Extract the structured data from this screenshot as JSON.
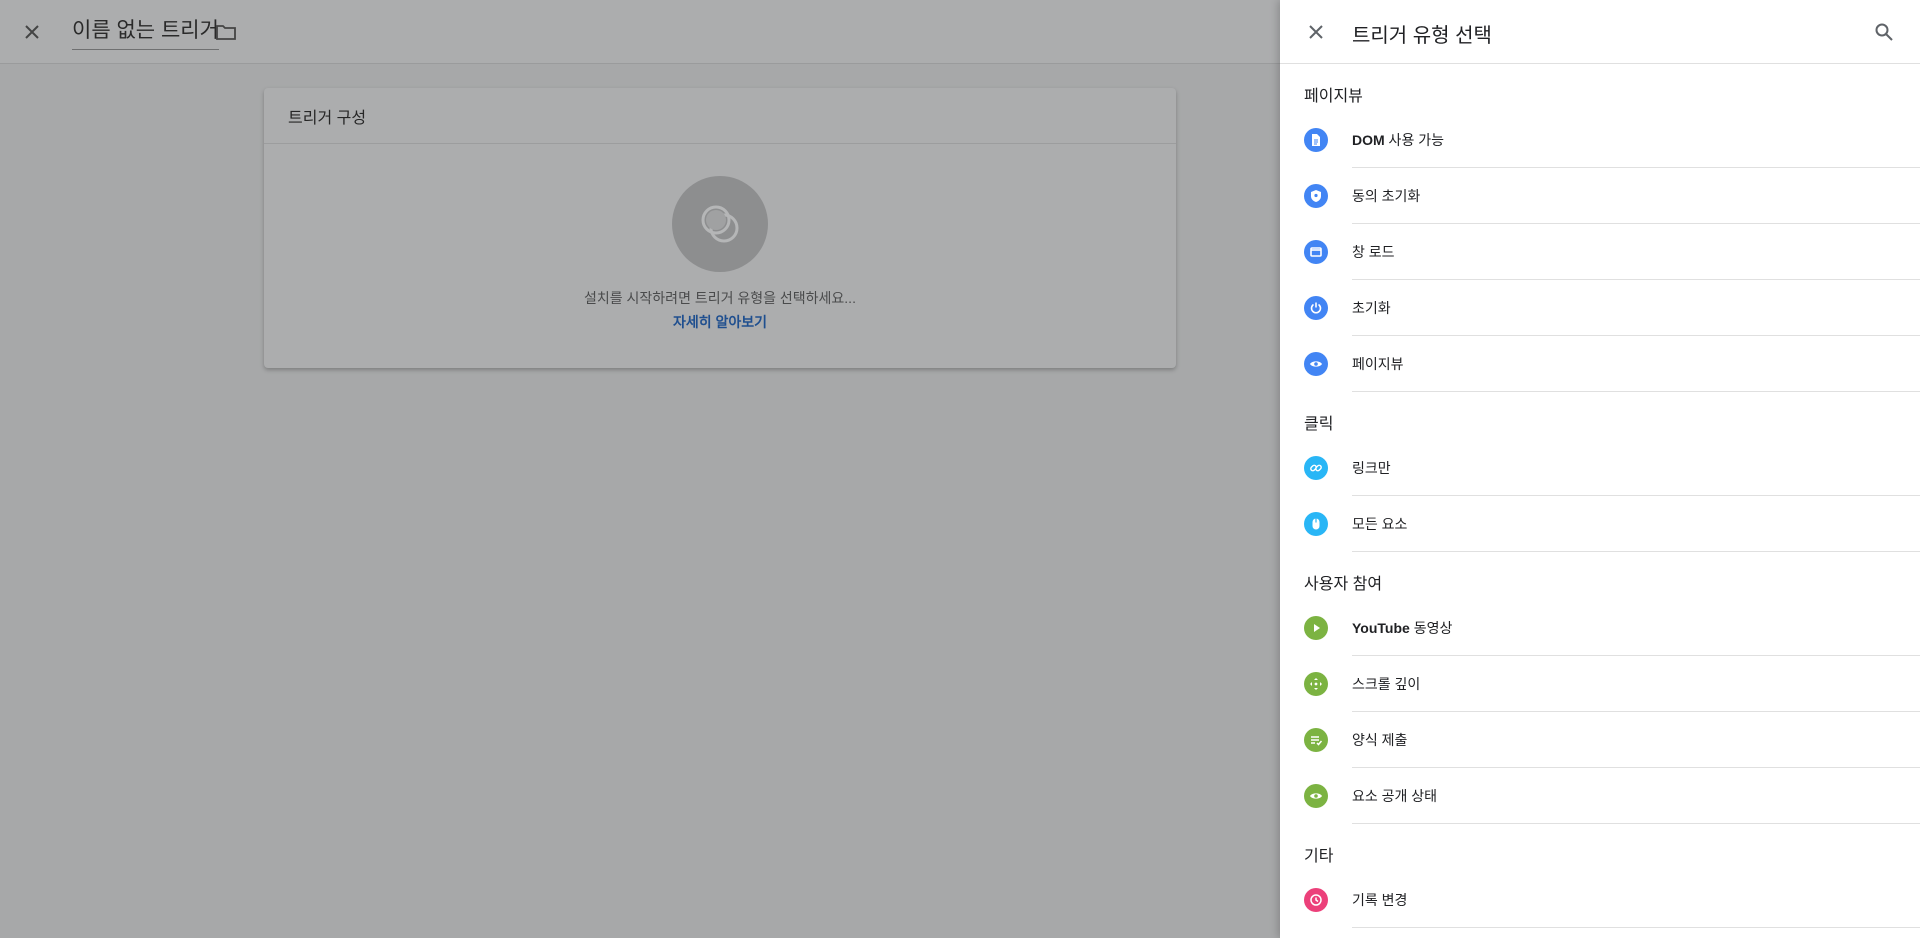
{
  "editor": {
    "title": "이름 없는 트리거",
    "card": {
      "header": "트리거 구성",
      "hint": "설치를 시작하려면 트리거 유형을 선택하세요...",
      "link": "자세히 알아보기"
    }
  },
  "drawer": {
    "title": "트리거 유형 선택",
    "sections": [
      {
        "title": "페이지뷰",
        "items": [
          {
            "bold": "DOM",
            "label": " 사용 가능",
            "icon": "document-icon",
            "color": "#4285f4"
          },
          {
            "bold": "",
            "label": "동의 초기화",
            "icon": "shield-icon",
            "color": "#4285f4"
          },
          {
            "bold": "",
            "label": "창 로드",
            "icon": "window-icon",
            "color": "#4285f4"
          },
          {
            "bold": "",
            "label": "초기화",
            "icon": "power-icon",
            "color": "#4285f4"
          },
          {
            "bold": "",
            "label": "페이지뷰",
            "icon": "eye-icon",
            "color": "#4285f4"
          }
        ]
      },
      {
        "title": "클릭",
        "items": [
          {
            "bold": "",
            "label": "링크만",
            "icon": "link-icon",
            "color": "#29b6f6"
          },
          {
            "bold": "",
            "label": "모든 요소",
            "icon": "mouse-icon",
            "color": "#29b6f6"
          }
        ]
      },
      {
        "title": "사용자 참여",
        "items": [
          {
            "bold": "YouTube",
            "label": " 동영상",
            "icon": "play-icon",
            "color": "#7cb342"
          },
          {
            "bold": "",
            "label": "스크롤 깊이",
            "icon": "scroll-icon",
            "color": "#7cb342"
          },
          {
            "bold": "",
            "label": "양식 제출",
            "icon": "form-icon",
            "color": "#7cb342"
          },
          {
            "bold": "",
            "label": "요소 공개 상태",
            "icon": "eye-icon",
            "color": "#7cb342"
          }
        ]
      },
      {
        "title": "기타",
        "items": [
          {
            "bold": "",
            "label": "기록 변경",
            "icon": "history-icon",
            "color": "#ec407a"
          }
        ]
      }
    ]
  }
}
